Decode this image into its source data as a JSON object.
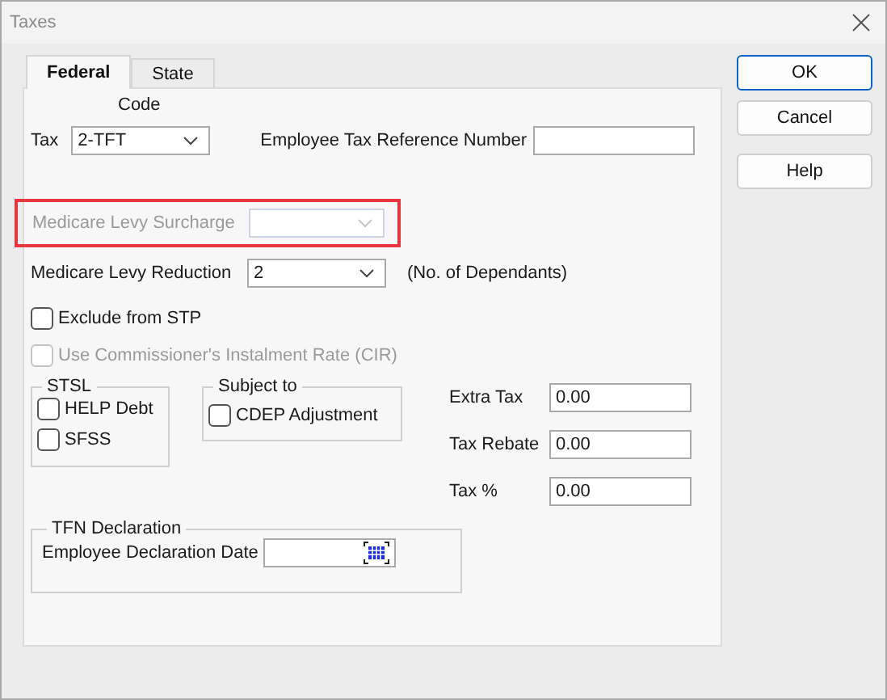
{
  "window": {
    "title": "Taxes"
  },
  "tabs": [
    {
      "label": "Federal",
      "selected": true
    },
    {
      "label": "State",
      "selected": false
    }
  ],
  "tax_code": {
    "heading": "Code",
    "label": "Tax",
    "value": "2-TFT"
  },
  "reference_number": {
    "label": "Employee Tax Reference Number"
  },
  "medicare_levy_surcharge": {
    "label": "Medicare Levy Surcharge",
    "disabled": true,
    "highlighted": true
  },
  "medicare_levy_reduction": {
    "label": "Medicare Levy Reduction",
    "value": "2",
    "note": "(No. of Dependants)"
  },
  "checkboxes": [
    {
      "label": "Exclude from STP",
      "checked": false,
      "disabled": false
    },
    {
      "label": "Use Commissioner's Instalment Rate (CIR)",
      "checked": false,
      "disabled": true
    }
  ],
  "stsl": {
    "title": "STSL",
    "items": [
      {
        "label": "HELP Debt",
        "checked": false
      },
      {
        "label": "SFSS",
        "checked": false
      }
    ]
  },
  "subject_to": {
    "title": "Subject to",
    "items": [
      {
        "label": "CDEP Adjustment",
        "checked": false
      }
    ]
  },
  "amounts": [
    {
      "label": "Extra Tax",
      "value": "0.00"
    },
    {
      "label": "Tax Rebate",
      "value": "0.00"
    },
    {
      "label": "Tax %",
      "value": "0.00"
    }
  ],
  "tfn_declaration": {
    "title": "TFN Declaration",
    "label": "Employee Declaration Date"
  },
  "buttons": [
    {
      "label": "OK",
      "default": true
    },
    {
      "label": "Cancel",
      "default": false
    },
    {
      "label": "Help",
      "default": false
    }
  ]
}
